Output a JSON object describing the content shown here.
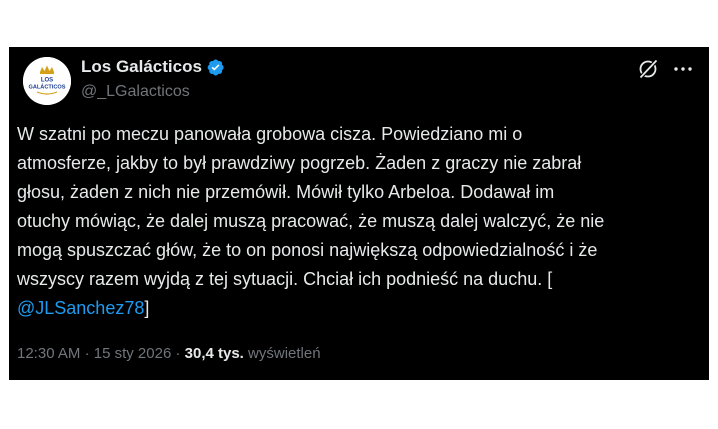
{
  "tweet": {
    "author": {
      "display_name": "Los Galácticos",
      "handle": "@_LGalacticos",
      "verified": true,
      "avatar_text": [
        "LOS",
        "GALÁCTICOS"
      ]
    },
    "body_lines": [
      "W szatni po meczu panowała grobowa cisza. Powiedziano mi o",
      "atmosferze, jakby to był prawdziwy pogrzeb. Żaden z graczy nie zabrał",
      "głosu, żaden z nich nie przemówił. Mówił tylko Arbeloa. Dodawał im",
      "otuchy mówiąc, że dalej muszą pracować, że muszą dalej walczyć, że nie",
      "mogą spuszczać głów, że to on ponosi największą odpowiedzialność i że",
      "wszyscy razem wyjdą z tej sytuacji. Chciał ich podnieść na duchu. ["
    ],
    "mention": "@JLSanchez78",
    "closing_bracket": "]",
    "time": "12:30 AM",
    "date": "15 sty 2026",
    "views_count": "30,4 tys.",
    "views_label": "wyświetleń",
    "separator": "·"
  },
  "icons": {
    "verified": "verified-badge-icon",
    "grok": "grok-icon",
    "more": "more-options-icon"
  },
  "colors": {
    "background": "#000000",
    "text_primary": "#e7e9ea",
    "text_secondary": "#71767b",
    "link": "#1d9bf0",
    "avatar_brand": "#1a3d8f",
    "avatar_gold": "#d4a017"
  }
}
